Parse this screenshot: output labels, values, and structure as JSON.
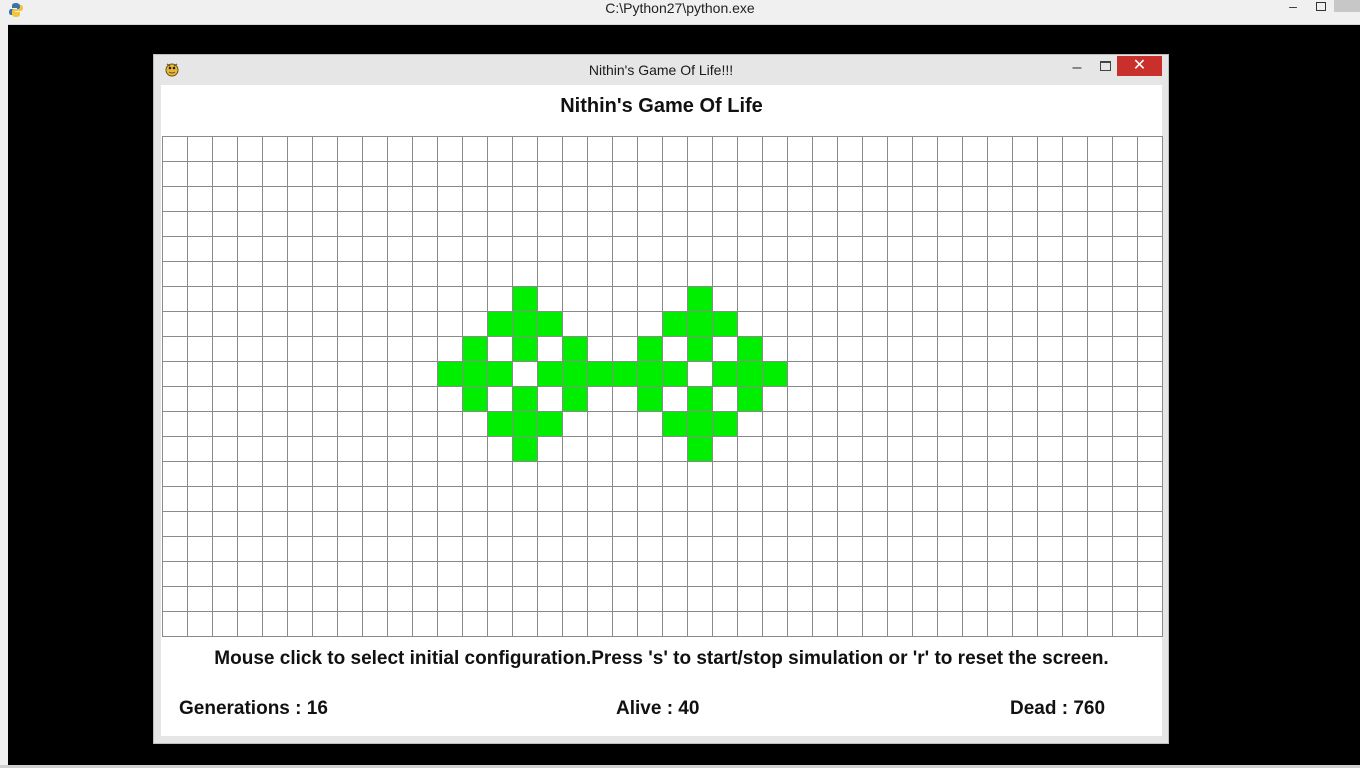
{
  "console": {
    "title": "C:\\Python27\\python.exe",
    "minimize_glyph": "‒",
    "close_glyph": "✕"
  },
  "window": {
    "title": "Nithin's Game Of Life!!!",
    "minimize_glyph": "–",
    "close_glyph": "✕",
    "icon": "pygame-snake-icon"
  },
  "game": {
    "heading": "Nithin's Game Of Life",
    "instructions": "Mouse click to select initial configuration.Press 's' to start/stop simulation or 'r' to reset the screen.",
    "generations_label": "Generations : 16",
    "alive_label": "Alive : 40",
    "dead_label": "Dead : 760",
    "grid": {
      "columns": 40,
      "rows": 20,
      "alive_color": "#00ee00",
      "line_color": "#8a8a8a",
      "alive_cells": [
        [
          6,
          14
        ],
        [
          6,
          21
        ],
        [
          7,
          13
        ],
        [
          7,
          14
        ],
        [
          7,
          15
        ],
        [
          7,
          20
        ],
        [
          7,
          21
        ],
        [
          7,
          22
        ],
        [
          8,
          12
        ],
        [
          8,
          14
        ],
        [
          8,
          16
        ],
        [
          8,
          19
        ],
        [
          8,
          21
        ],
        [
          8,
          23
        ],
        [
          9,
          11
        ],
        [
          9,
          12
        ],
        [
          9,
          13
        ],
        [
          9,
          15
        ],
        [
          9,
          16
        ],
        [
          9,
          17
        ],
        [
          9,
          18
        ],
        [
          9,
          19
        ],
        [
          9,
          20
        ],
        [
          9,
          22
        ],
        [
          9,
          23
        ],
        [
          9,
          24
        ],
        [
          10,
          12
        ],
        [
          10,
          14
        ],
        [
          10,
          16
        ],
        [
          10,
          19
        ],
        [
          10,
          21
        ],
        [
          10,
          23
        ],
        [
          11,
          13
        ],
        [
          11,
          14
        ],
        [
          11,
          15
        ],
        [
          11,
          20
        ],
        [
          11,
          21
        ],
        [
          11,
          22
        ],
        [
          12,
          14
        ],
        [
          12,
          21
        ]
      ]
    }
  }
}
